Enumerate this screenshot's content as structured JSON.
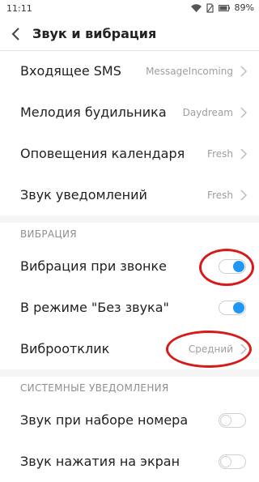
{
  "status": {
    "time": "11:11",
    "battery": "89%"
  },
  "header": {
    "title": "Звук и вибрация"
  },
  "sound_items": [
    {
      "label": "Входящее SMS",
      "value": "MessageIncoming"
    },
    {
      "label": "Мелодия будильника",
      "value": "Daydream"
    },
    {
      "label": "Оповещения календаря",
      "value": "Fresh"
    },
    {
      "label": "Звук уведомлений",
      "value": "Fresh"
    }
  ],
  "vibration": {
    "section_title": "ВИБРАЦИЯ",
    "ring_label": "Вибрация при звонке",
    "ring_on": true,
    "silent_label": "В режиме \"Без звука\"",
    "silent_on": true,
    "feedback_label": "Виброотклик",
    "feedback_value": "Средний"
  },
  "system": {
    "section_title": "СИСТЕМНЫЕ УВЕДОМЛЕНИЯ",
    "dial_label": "Звук при наборе номера",
    "dial_on": false,
    "touch_label": "Звук нажатия на экран",
    "touch_on": false
  },
  "colors": {
    "accent": "#2196f3",
    "annotation": "#d71b1b"
  }
}
